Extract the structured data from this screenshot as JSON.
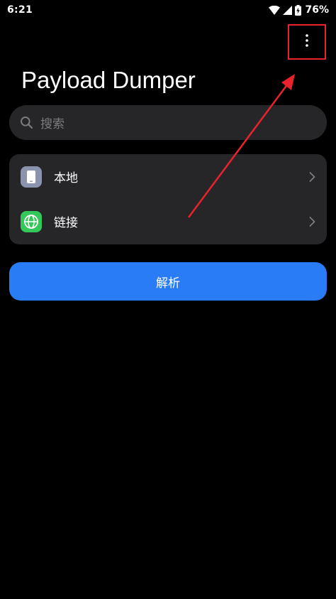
{
  "status_bar": {
    "time": "6:21",
    "battery_percent": "76%",
    "icons": [
      "wifi-icon",
      "signal-icon",
      "battery-charging-icon"
    ]
  },
  "toolbar": {
    "overflow_icon": "more-vertical-icon"
  },
  "header": {
    "title": "Payload Dumper"
  },
  "search": {
    "placeholder": "搜索",
    "icon": "search-icon"
  },
  "source_list": {
    "items": [
      {
        "label": "本地",
        "icon": "phone-icon",
        "icon_color": "#8a94ac"
      },
      {
        "label": "链接",
        "icon": "globe-icon",
        "icon_color": "#34c759"
      }
    ]
  },
  "actions": {
    "parse_label": "解析",
    "parse_color": "#2a7cf6"
  },
  "annotation": {
    "color": "#e8232d"
  }
}
